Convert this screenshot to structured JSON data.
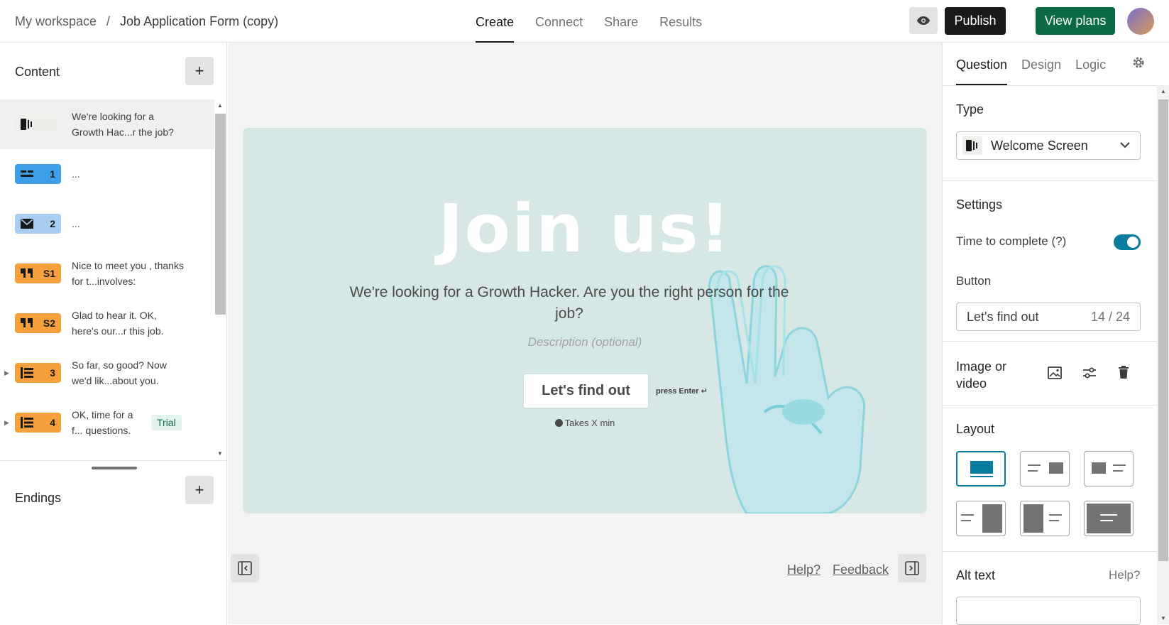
{
  "header": {
    "breadcrumb_workspace": "My workspace",
    "breadcrumb_sep": "/",
    "breadcrumb_form": "Job Application Form (copy)",
    "tabs": [
      {
        "label": "Create"
      },
      {
        "label": "Connect"
      },
      {
        "label": "Share"
      },
      {
        "label": "Results"
      }
    ],
    "active_tab": "Create",
    "publish_label": "Publish",
    "plans_label": "View plans"
  },
  "left": {
    "content_title": "Content",
    "endings_title": "Endings",
    "items": [
      {
        "badge": "",
        "text": "We're looking for a Growth Hac...r the job?",
        "color": "#f0eeea",
        "icon": "welcome-screen-icon"
      },
      {
        "badge": "1",
        "text": "...",
        "color": "#3d9fe8",
        "icon": "short-text-icon"
      },
      {
        "badge": "2",
        "text": "...",
        "color": "#a7cdf0",
        "icon": "email-icon"
      },
      {
        "badge": "S1",
        "text": "Nice to meet you , thanks for t...involves:",
        "color": "#f5a03c",
        "icon": "quote-icon"
      },
      {
        "badge": "S2",
        "text": "Glad to hear it. OK, here's our...r this job.",
        "color": "#f5a03c",
        "icon": "quote-icon"
      },
      {
        "badge": "3",
        "text": "So far, so good? Now we'd lik...about you.",
        "color": "#f5a03c",
        "icon": "question-group-icon"
      },
      {
        "badge": "4",
        "text": "OK, time for a f... questions.",
        "color": "#f5a03c",
        "icon": "question-group-icon"
      }
    ],
    "trial_label": "Trial"
  },
  "canvas": {
    "headline": "Join us!",
    "subtitle": "We're looking for a Growth Hacker. Are you the right person for the job?",
    "description_placeholder": "Description (optional)",
    "cta_label": "Let's find out",
    "enter_hint": "press Enter ↵",
    "takes": "Takes X min",
    "help_link": "Help?",
    "feedback_link": "Feedback",
    "card_color": "#d7e7e6"
  },
  "right": {
    "tabs": [
      {
        "label": "Question"
      },
      {
        "label": "Design"
      },
      {
        "label": "Logic"
      }
    ],
    "type_label": "Type",
    "type_value": "Welcome Screen",
    "settings_label": "Settings",
    "time_label": "Time to complete (?)",
    "time_enabled": true,
    "button_label": "Button",
    "button_value": "Let's find out",
    "button_count": "14 / 24",
    "image_label": "Image or video",
    "layout_label": "Layout",
    "alt_label": "Alt text",
    "alt_help": "Help?",
    "accent": "#0a7d9e"
  }
}
